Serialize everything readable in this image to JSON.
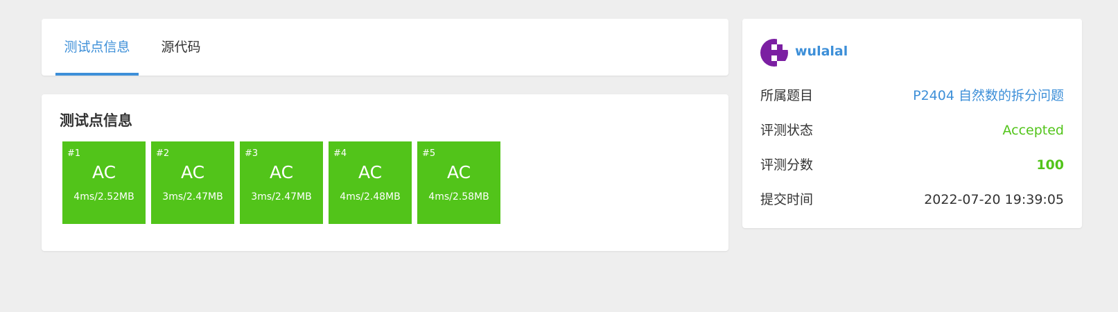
{
  "tabs": [
    {
      "label": "测试点信息",
      "active": true
    },
    {
      "label": "源代码",
      "active": false
    }
  ],
  "testcases": {
    "title": "测试点信息",
    "items": [
      {
        "num": "#1",
        "status": "AC",
        "meta": "4ms/2.52MB"
      },
      {
        "num": "#2",
        "status": "AC",
        "meta": "3ms/2.47MB"
      },
      {
        "num": "#3",
        "status": "AC",
        "meta": "3ms/2.47MB"
      },
      {
        "num": "#4",
        "status": "AC",
        "meta": "4ms/2.48MB"
      },
      {
        "num": "#5",
        "status": "AC",
        "meta": "4ms/2.58MB"
      }
    ]
  },
  "submission": {
    "username": "wulalal",
    "rows": [
      {
        "label": "所属题目",
        "value": "P2404 自然数的拆分问题"
      },
      {
        "label": "评测状态",
        "value": "Accepted"
      },
      {
        "label": "评测分数",
        "value": "100"
      },
      {
        "label": "提交时间",
        "value": "2022-07-20 19:39:05"
      }
    ]
  },
  "colors": {
    "accent": "#3d8fd8",
    "accepted": "#52c41a",
    "avatar": "#7b1fa2",
    "background": "#eeeeee"
  },
  "icons": {
    "avatar": "identicon-avatar"
  }
}
